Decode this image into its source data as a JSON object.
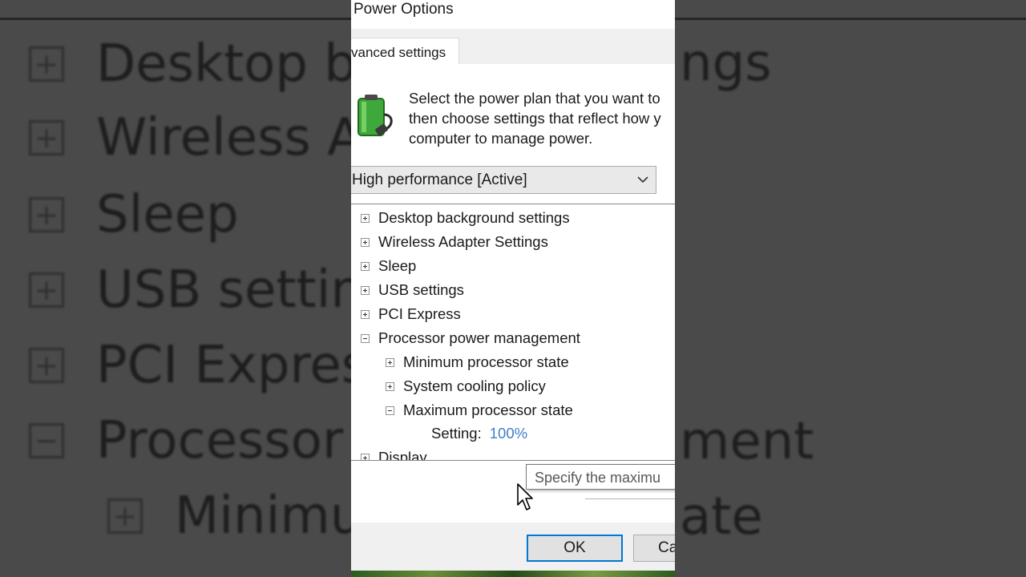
{
  "background": {
    "left_rows": [
      {
        "symbol": "+",
        "text": "Desktop ba"
      },
      {
        "symbol": "+",
        "text": "Wireless Ad"
      },
      {
        "symbol": "+",
        "text": "Sleep"
      },
      {
        "symbol": "+",
        "text": "USB setting"
      },
      {
        "symbol": "+",
        "text": "PCI Express"
      },
      {
        "symbol": "−",
        "text": "Processor p"
      },
      {
        "symbol": "+",
        "text": "Minimu"
      }
    ],
    "right_fragments": [
      "ngs",
      "ment",
      "ate"
    ]
  },
  "window": {
    "title": "Power Options"
  },
  "tabs": [
    {
      "label": "vanced settings",
      "active": true
    }
  ],
  "description": {
    "lines": [
      "Select the power plan that you want to",
      "then choose settings that reflect how y",
      "computer to manage power."
    ]
  },
  "plan_select": {
    "selected": "High performance [Active]",
    "icon": "chevron-down-icon"
  },
  "tree": {
    "items": [
      {
        "label": "Desktop background settings",
        "state": "collapsed",
        "level": 0
      },
      {
        "label": "Wireless Adapter Settings",
        "state": "collapsed",
        "level": 0
      },
      {
        "label": "Sleep",
        "state": "collapsed",
        "level": 0
      },
      {
        "label": "USB settings",
        "state": "collapsed",
        "level": 0
      },
      {
        "label": "PCI Express",
        "state": "collapsed",
        "level": 0
      },
      {
        "label": "Processor power management",
        "state": "expanded",
        "level": 0
      },
      {
        "label": "Minimum processor state",
        "state": "collapsed",
        "level": 1
      },
      {
        "label": "System cooling policy",
        "state": "collapsed",
        "level": 1
      },
      {
        "label": "Maximum processor state",
        "state": "expanded",
        "level": 1
      },
      {
        "label": "Display",
        "state": "collapsed",
        "level": 0
      }
    ],
    "setting": {
      "label": "Setting:",
      "value": "100%"
    }
  },
  "tooltip": {
    "text": "Specify the maximu"
  },
  "buttons": {
    "ok": "OK",
    "cancel": "Ca"
  },
  "colors": {
    "accent": "#0078d7",
    "link": "#3f7fc8",
    "dialog_bg": "#f0f0f0"
  }
}
